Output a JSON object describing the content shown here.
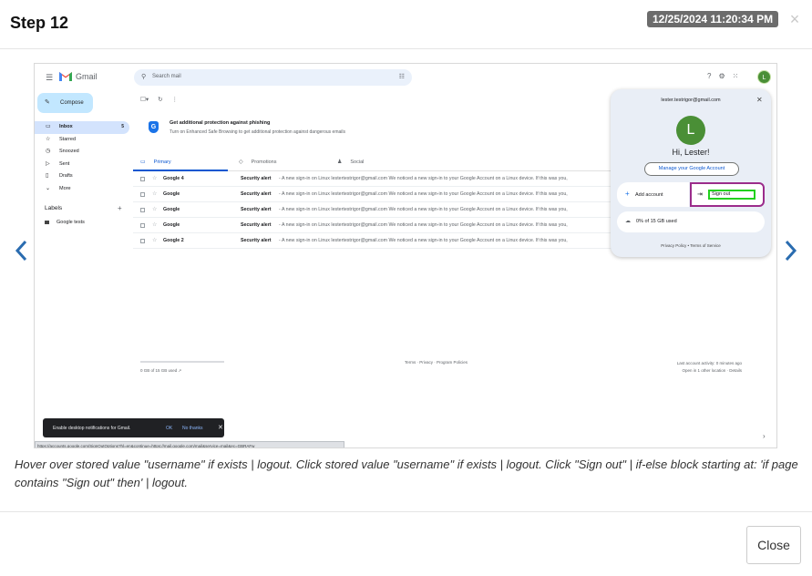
{
  "modal": {
    "title": "Step 12",
    "timestamp": "12/25/2024 11:20:34 PM",
    "close_glyph": "×",
    "caption": "Hover over stored value \"username\" if exists | logout. Click stored value \"username\" if exists | logout. Click \"Sign out\" | if-else block starting at: 'if page contains \"Sign out\" then' | logout.",
    "close_button": "Close"
  },
  "gmail": {
    "brand": "Gmail",
    "search_placeholder": "Search mail",
    "compose": "Compose",
    "nav": [
      {
        "label": "Inbox",
        "count": "5",
        "icon": "inbox-icon",
        "glyph": "▭"
      },
      {
        "label": "Starred",
        "count": "",
        "icon": "star-icon",
        "glyph": "☆"
      },
      {
        "label": "Snoozed",
        "count": "",
        "icon": "clock-icon",
        "glyph": "◷"
      },
      {
        "label": "Sent",
        "count": "",
        "icon": "send-icon",
        "glyph": "▷"
      },
      {
        "label": "Drafts",
        "count": "",
        "icon": "draft-icon",
        "glyph": "▯"
      },
      {
        "label": "More",
        "count": "",
        "icon": "chevron-down-icon",
        "glyph": "⌄"
      }
    ],
    "labels_header": "Labels",
    "label_items": [
      "Google tests"
    ],
    "banner": {
      "title": "Get additional protection against phishing",
      "subtitle": "Turn on Enhanced Safe Browsing to get additional protection against dangerous emails"
    },
    "tabs": [
      "Primary",
      "Promotions",
      "Social"
    ],
    "emails": [
      {
        "sender": "Google 4",
        "subject": "Security alert",
        "snippet": " - A new sign-in on Linux lestertestrigor@gmail.com We noticed a new sign-in to your Google Account on a Linux device. If this was you,"
      },
      {
        "sender": "Google",
        "subject": "Security alert",
        "snippet": " - A new sign-in on Linux lestertestrigor@gmail.com We noticed a new sign-in to your Google Account on a Linux device. If this was you,"
      },
      {
        "sender": "Google",
        "subject": "Security alert",
        "snippet": " - A new sign-in on Linux lestertestrigor@gmail.com We noticed a new sign-in to your Google Account on a Linux device. If this was you,"
      },
      {
        "sender": "Google",
        "subject": "Security alert",
        "snippet": " - A new sign-in on Linux lestertestrigor@gmail.com We noticed a new sign-in to your Google Account on a Linux device. If this was you,"
      },
      {
        "sender": "Google 2",
        "subject": "Security alert",
        "snippet": " - A new sign-in on Linux lestertestrigor@gmail.com We noticed a new sign-in to your Google Account on a Linux device. If this was you,"
      }
    ],
    "footer_storage": "0 GB of 15 GB used",
    "footer_links": "Terms · Privacy · Program Policies",
    "footer_activity": "Last account activity: 0 minutes ago",
    "footer_details": "Open in 1 other location · Details",
    "account": {
      "email": "lester.testrigor@gmail.com",
      "avatar_letter": "L",
      "greeting": "Hi, Lester!",
      "manage": "Manage your Google Account",
      "add_account": "Add account",
      "sign_out": "Sign out",
      "storage": "0% of 15 GB used",
      "links": "Privacy Policy  •  Terms of Service"
    },
    "toast": {
      "message": "Enable desktop notifications for Gmail.",
      "ok": "OK",
      "no_thanks": "No thanks"
    },
    "status_url": "https://accounts.google.com/SignOutOptions?hl=en&continue=https://mail.google.com/mail&service=mail&ec=GBRAFw"
  },
  "colors": {
    "highlight_outer": "#9b2c8b",
    "highlight_inner": "#22d11e",
    "accent": "#0b57d0"
  }
}
